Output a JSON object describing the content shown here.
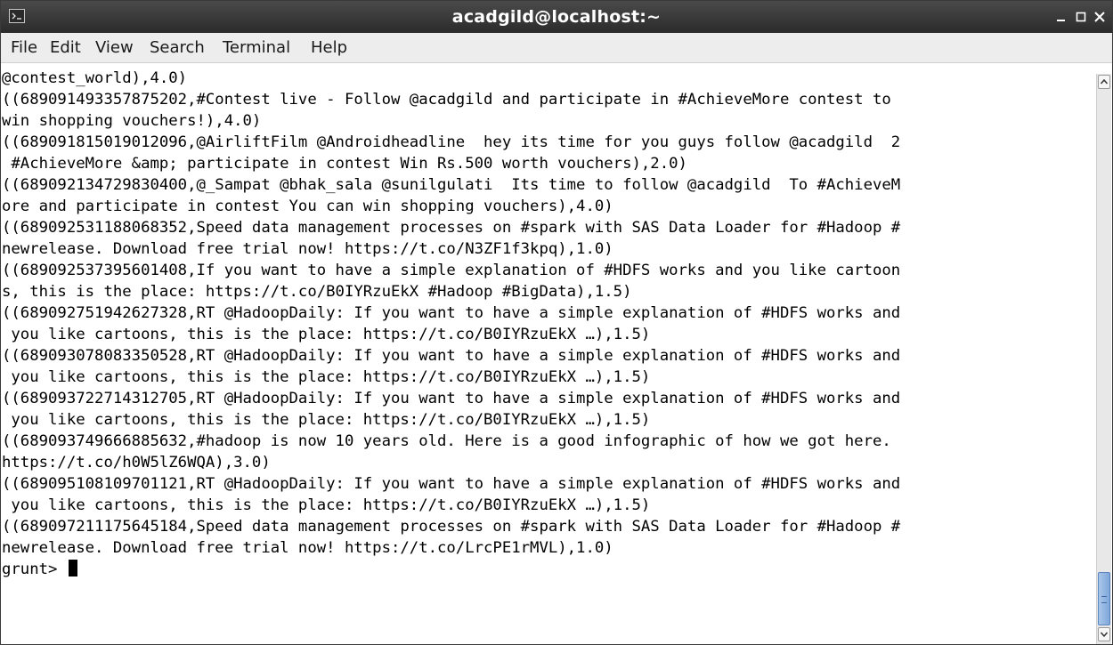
{
  "window": {
    "title": "acadgild@localhost:~"
  },
  "icons": {
    "app": "terminal-icon",
    "minimize": "minimize-icon",
    "maximize": "maximize-icon",
    "close": "close-icon",
    "scroll_up": "chevron-up-icon",
    "scroll_down": "chevron-down-icon"
  },
  "colors": {
    "titlebar": "#2b2b2b",
    "menubar": "#ededed",
    "terminal_bg": "#ffffff",
    "terminal_fg": "#000000",
    "scroll_thumb": "#7ea7da"
  },
  "menubar": {
    "items": [
      "File",
      "Edit",
      "View",
      "Search",
      "Terminal",
      "Help"
    ]
  },
  "terminal": {
    "lines": [
      "@contest_world),4.0)",
      "((689091493357875202,#Contest live - Follow @acadgild and participate in #AchieveMore contest to",
      "win shopping vouchers!),4.0)",
      "((689091815019012096,@AirliftFilm @Androidheadline  hey its time for you guys follow @acadgild  2",
      " #AchieveMore &amp; participate in contest Win Rs.500 worth vouchers),2.0)",
      "((689092134729830400,@_Sampat @bhak_sala @sunilgulati  Its time to follow @acadgild  To #AchieveM",
      "ore and participate in contest You can win shopping vouchers),4.0)",
      "((689092531188068352,Speed data management processes on #spark with SAS Data Loader for #Hadoop #",
      "newrelease. Download free trial now! https://t.co/N3ZF1f3kpq),1.0)",
      "((689092537395601408,If you want to have a simple explanation of #HDFS works and you like cartoon",
      "s, this is the place: https://t.co/B0IYRzuEkX #Hadoop #BigData),1.5)",
      "((689092751942627328,RT @HadoopDaily: If you want to have a simple explanation of #HDFS works and",
      " you like cartoons, this is the place: https://t.co/B0IYRzuEkX …),1.5)",
      "((689093078083350528,RT @HadoopDaily: If you want to have a simple explanation of #HDFS works and",
      " you like cartoons, this is the place: https://t.co/B0IYRzuEkX …),1.5)",
      "((689093722714312705,RT @HadoopDaily: If you want to have a simple explanation of #HDFS works and",
      " you like cartoons, this is the place: https://t.co/B0IYRzuEkX …),1.5)",
      "((689093749666885632,#hadoop is now 10 years old. Here is a good infographic of how we got here.",
      "https://t.co/h0W5lZ6WQA),3.0)",
      "((689095108109701121,RT @HadoopDaily: If you want to have a simple explanation of #HDFS works and",
      " you like cartoons, this is the place: https://t.co/B0IYRzuEkX …),1.5)",
      "((689097211175645184,Speed data management processes on #spark with SAS Data Loader for #Hadoop #",
      "newrelease. Download free trial now! https://t.co/LrcPE1rMVL),1.0)"
    ],
    "prompt": "grunt> "
  }
}
